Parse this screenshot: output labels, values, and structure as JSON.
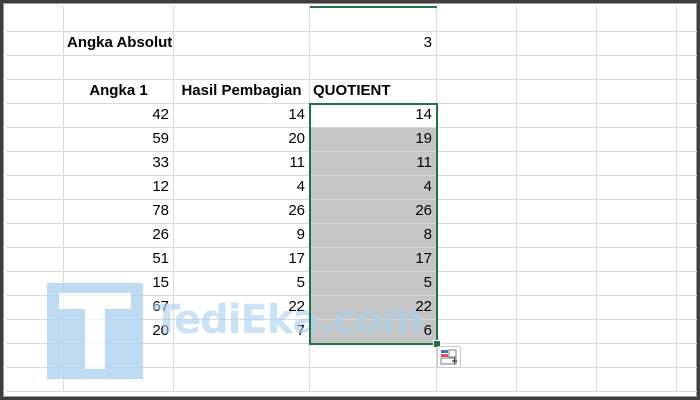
{
  "sheet": {
    "absolute_label": "Angka Absolut",
    "absolute_value": "3",
    "headers": {
      "angka1": "Angka 1",
      "hasil": "Hasil Pembagian",
      "quotient": "QUOTIENT"
    },
    "rows": [
      {
        "angka1": "42",
        "hasil": "14",
        "quotient": "14"
      },
      {
        "angka1": "59",
        "hasil": "20",
        "quotient": "19"
      },
      {
        "angka1": "33",
        "hasil": "11",
        "quotient": "11"
      },
      {
        "angka1": "12",
        "hasil": "4",
        "quotient": "4"
      },
      {
        "angka1": "78",
        "hasil": "26",
        "quotient": "26"
      },
      {
        "angka1": "26",
        "hasil": "9",
        "quotient": "8"
      },
      {
        "angka1": "51",
        "hasil": "17",
        "quotient": "17"
      },
      {
        "angka1": "15",
        "hasil": "5",
        "quotient": "5"
      },
      {
        "angka1": "67",
        "hasil": "22",
        "quotient": "22"
      },
      {
        "angka1": "20",
        "hasil": "7",
        "quotient": "6"
      }
    ]
  },
  "watermark": {
    "text": "TediEka.com"
  },
  "colors": {
    "selection_border": "#217346",
    "selection_fill": "#c6c6c6",
    "gridline": "#d9d9d9"
  },
  "icons": {
    "quick_analysis": "quick-analysis-icon"
  }
}
